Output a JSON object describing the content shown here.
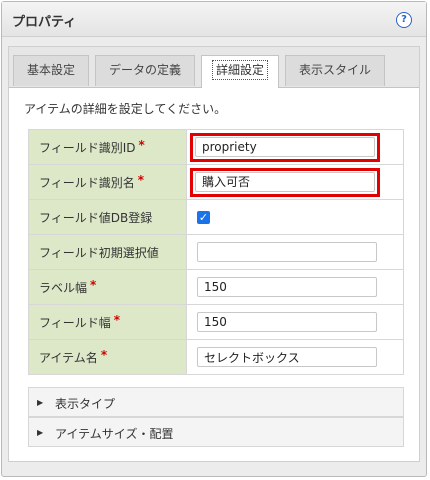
{
  "panel": {
    "title": "プロパティ",
    "help_icon": "?"
  },
  "tabs": [
    {
      "label": "基本設定"
    },
    {
      "label": "データの定義"
    },
    {
      "label": "詳細設定"
    },
    {
      "label": "表示スタイル"
    }
  ],
  "description": "アイテムの詳細を設定してください。",
  "fields": {
    "field_id": {
      "label": "フィールド識別ID",
      "required": "*",
      "value": "propriety"
    },
    "field_name": {
      "label": "フィールド識別名",
      "required": "*",
      "value": "購入可否"
    },
    "db_register": {
      "label": "フィールド値DB登録",
      "checked_glyph": "✓"
    },
    "initial_value": {
      "label": "フィールド初期選択値",
      "value": ""
    },
    "label_width": {
      "label": "ラベル幅",
      "required": "*",
      "value": "150"
    },
    "field_width": {
      "label": "フィールド幅",
      "required": "*",
      "value": "150"
    },
    "item_name": {
      "label": "アイテム名",
      "required": "*",
      "value": "セレクトボックス"
    }
  },
  "sections": [
    {
      "label": "表示タイプ",
      "arrow": "▶"
    },
    {
      "label": "アイテムサイズ・配置",
      "arrow": "▶"
    }
  ],
  "colors": {
    "label_bg": "#dde8c9",
    "required": "#d00000",
    "highlight": "#e20000",
    "checkbox": "#1a73e8"
  }
}
